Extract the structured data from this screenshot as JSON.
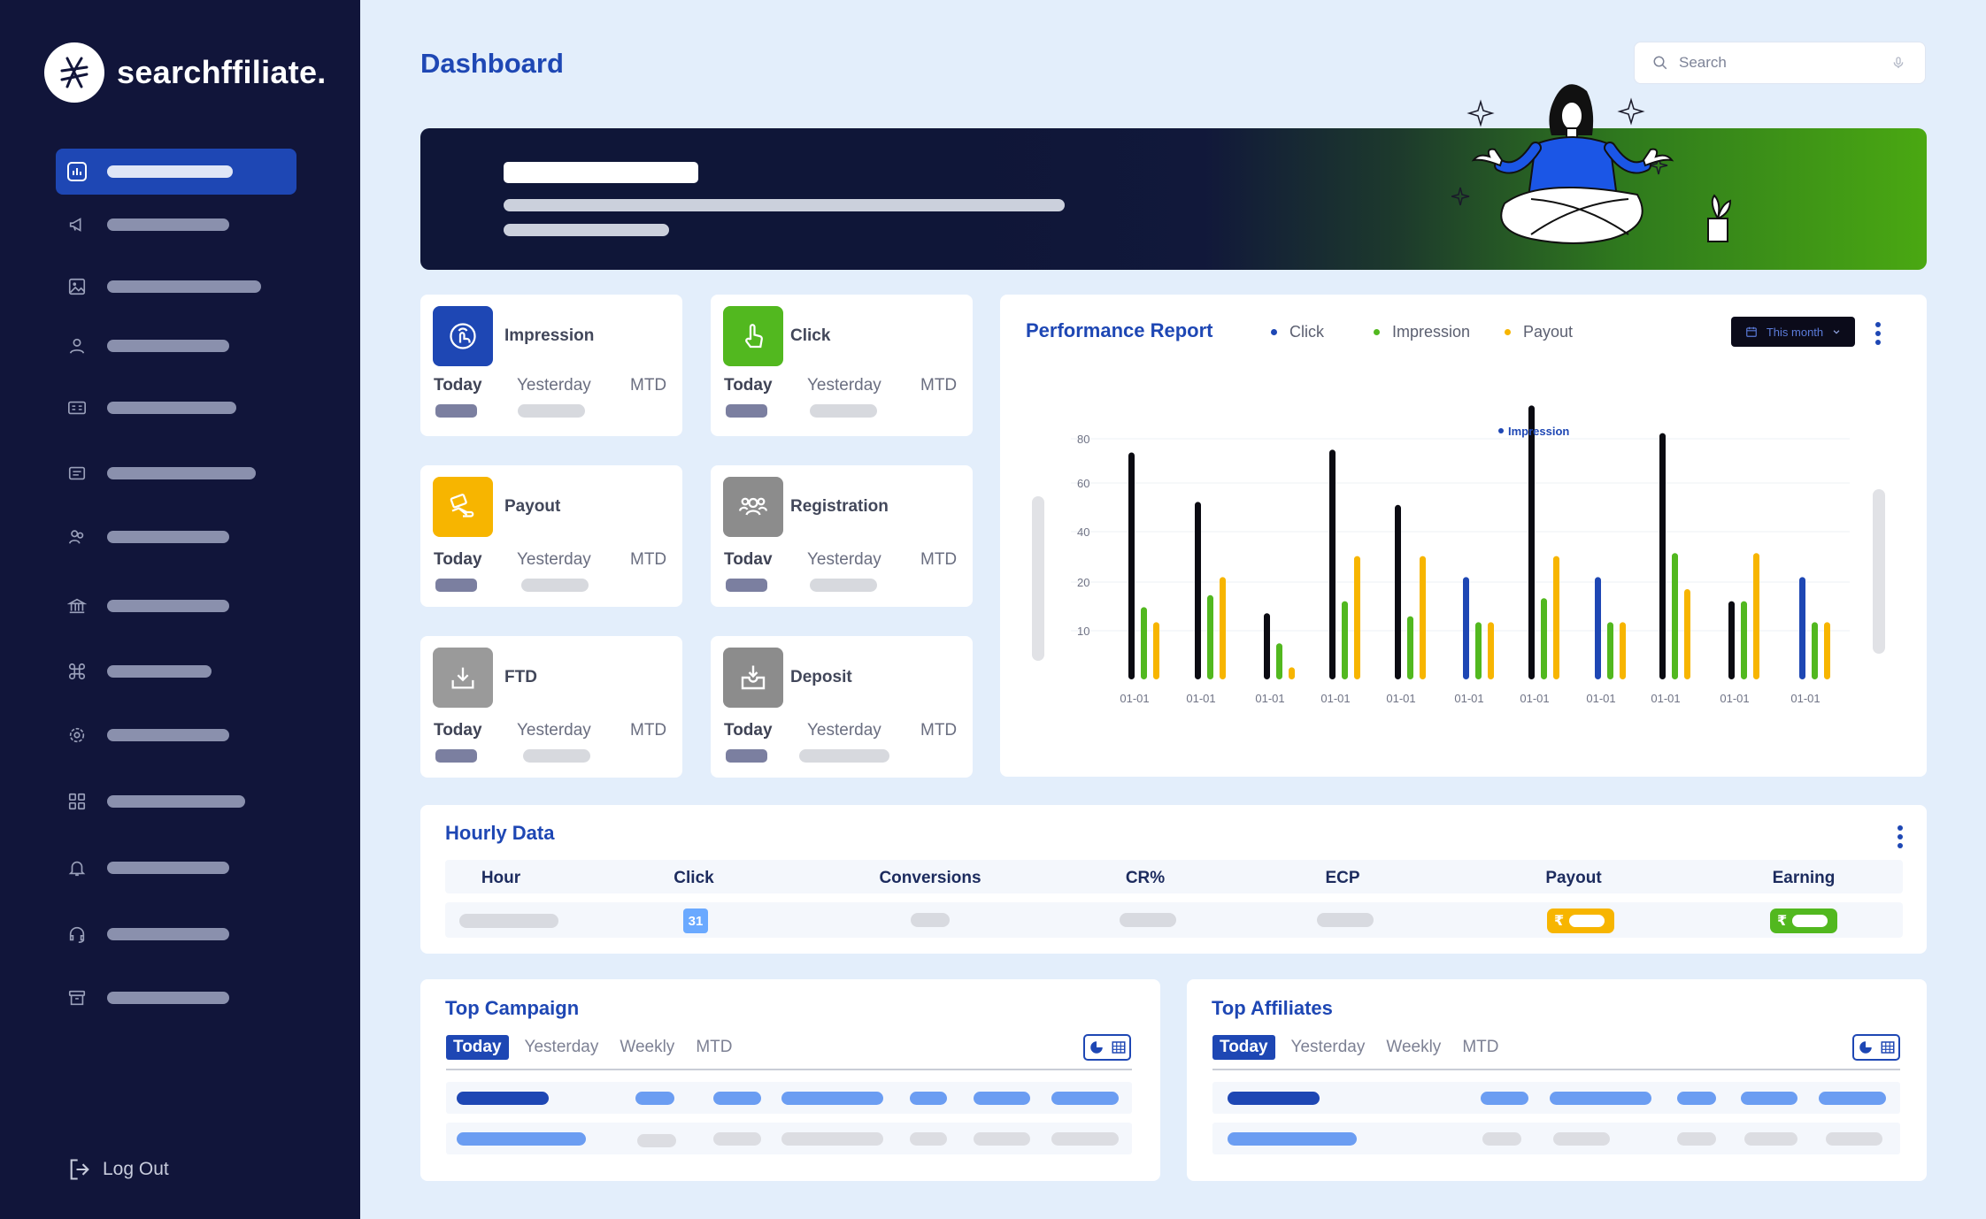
{
  "brand": {
    "name": "searchffiliate."
  },
  "sidebar": {
    "items": [
      {
        "icon": "chart-bar-icon",
        "active": true
      },
      {
        "icon": "megaphone-icon"
      },
      {
        "icon": "image-icon"
      },
      {
        "icon": "user-icon"
      },
      {
        "icon": "id-card-icon"
      },
      {
        "icon": "document-icon"
      },
      {
        "icon": "users-icon"
      },
      {
        "icon": "bank-icon"
      },
      {
        "icon": "command-icon"
      },
      {
        "icon": "gear-icon"
      },
      {
        "icon": "grid-icon"
      },
      {
        "icon": "bell-icon"
      },
      {
        "icon": "headset-icon"
      },
      {
        "icon": "archive-icon"
      }
    ],
    "logout_label": "Log Out"
  },
  "header": {
    "title": "Dashboard",
    "search_placeholder": "Search"
  },
  "stats": {
    "periods": {
      "today": "Today",
      "yesterday": "Yesterday",
      "mtd": "MTD",
      "today_alt": "Todav"
    },
    "cards": [
      {
        "name": "impression",
        "title": "Impression",
        "color": "#1e47b4"
      },
      {
        "name": "click",
        "title": "Click",
        "color": "#52b81f"
      },
      {
        "name": "payout",
        "title": "Payout",
        "color": "#f7b500"
      },
      {
        "name": "registration",
        "title": "Registration",
        "color": "#8c8c8c"
      },
      {
        "name": "ftd",
        "title": "FTD",
        "color": "#9a9a9a"
      },
      {
        "name": "deposit",
        "title": "Deposit",
        "color": "#8c8c8c"
      }
    ]
  },
  "performance": {
    "title": "Performance Report",
    "legend": [
      {
        "label": "Click",
        "color": "#1e47b4"
      },
      {
        "label": "Impression",
        "color": "#52b81f"
      },
      {
        "label": "Payout",
        "color": "#f7b500"
      }
    ],
    "range_label": "This month",
    "annotation": "Impression"
  },
  "chart_data": {
    "type": "bar",
    "categories": [
      "01-01",
      "01-01",
      "01-01",
      "01-01",
      "01-01",
      "01-01",
      "01-01",
      "01-01",
      "01-01",
      "01-01",
      "01-01"
    ],
    "yticks": [
      80,
      60,
      40,
      20,
      10
    ],
    "ylim": [
      0,
      80
    ],
    "groups": [
      [
        {
          "value": 82,
          "color": "#0b0b12"
        },
        {
          "value": 24,
          "color": "#52b81f"
        },
        {
          "value": 19,
          "color": "#f7b500"
        }
      ],
      [
        {
          "value": 59,
          "color": "#0b0b12"
        },
        {
          "value": 28,
          "color": "#52b81f"
        },
        {
          "value": 34,
          "color": "#f7b500"
        }
      ],
      [
        {
          "value": 22,
          "color": "#0b0b12"
        },
        {
          "value": 12,
          "color": "#52b81f"
        },
        {
          "value": 4,
          "color": "#f7b500"
        }
      ],
      [
        {
          "value": 83,
          "color": "#0b0b12"
        },
        {
          "value": 26,
          "color": "#52b81f"
        },
        {
          "value": 41,
          "color": "#f7b500"
        }
      ],
      [
        {
          "value": 58,
          "color": "#0b0b12"
        },
        {
          "value": 21,
          "color": "#52b81f"
        },
        {
          "value": 41,
          "color": "#f7b500"
        }
      ],
      [
        {
          "value": 34,
          "color": "#1e47b4"
        },
        {
          "value": 19,
          "color": "#52b81f"
        },
        {
          "value": 19,
          "color": "#f7b500"
        }
      ],
      [
        {
          "value": 99,
          "color": "#0b0b12"
        },
        {
          "value": 27,
          "color": "#52b81f"
        },
        {
          "value": 41,
          "color": "#f7b500"
        }
      ],
      [
        {
          "value": 34,
          "color": "#1e47b4"
        },
        {
          "value": 19,
          "color": "#52b81f"
        },
        {
          "value": 19,
          "color": "#f7b500"
        }
      ],
      [
        {
          "value": 89,
          "color": "#0b0b12"
        },
        {
          "value": 42,
          "color": "#52b81f"
        },
        {
          "value": 30,
          "color": "#f7b500"
        }
      ],
      [
        {
          "value": 26,
          "color": "#0b0b12"
        },
        {
          "value": 26,
          "color": "#52b81f"
        },
        {
          "value": 42,
          "color": "#f7b500"
        }
      ],
      [
        {
          "value": 34,
          "color": "#1e47b4"
        },
        {
          "value": 19,
          "color": "#52b81f"
        },
        {
          "value": 19,
          "color": "#f7b500"
        }
      ]
    ],
    "grid": true
  },
  "hourly": {
    "title": "Hourly Data",
    "columns": [
      "Hour",
      "Click",
      "Conversions",
      "CR%",
      "ECP",
      "Payout",
      "Earning"
    ],
    "row": {
      "click_badge": "31",
      "rupee_symbol": "₹"
    }
  },
  "top_campaign": {
    "title": "Top Campaign",
    "tabs": [
      "Today",
      "Yesterday",
      "Weekly",
      "MTD"
    ],
    "active_tab": "Today"
  },
  "top_affiliates": {
    "title": "Top Affiliates",
    "tabs": [
      "Today",
      "Yesterday",
      "Weekly",
      "MTD"
    ],
    "active_tab": "Today"
  }
}
